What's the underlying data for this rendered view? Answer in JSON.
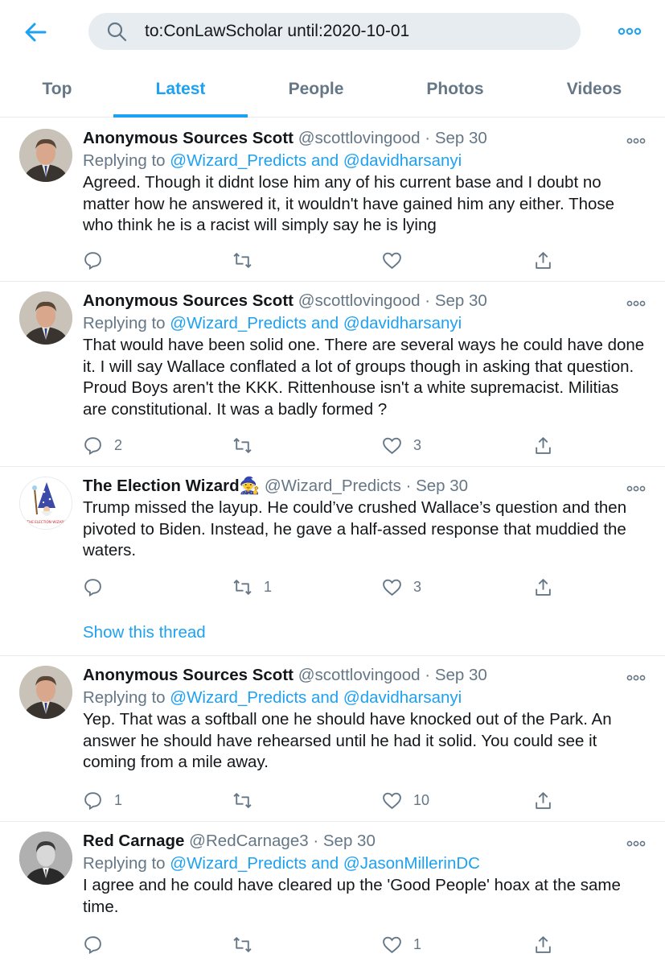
{
  "search": {
    "query": "to:ConLawScholar until:2020-10-01"
  },
  "tabs": [
    "Top",
    "Latest",
    "People",
    "Photos",
    "Videos"
  ],
  "active_tab": "Latest",
  "colors": {
    "accent": "#1da1f2",
    "muted": "#657786",
    "text": "#14171a",
    "divider": "#e6ecf0"
  },
  "tweets": [
    {
      "name": "Anonymous Sources Scott",
      "handle": "@scottlovingood",
      "dot": "·",
      "date": "Sep 30",
      "reply_prefix": "Replying to",
      "reply_to": "@Wizard_Predicts and @davidharsanyi",
      "text": "Agreed. Though it didnt lose him any of his current base and I doubt no matter how he answered it, it wouldn't have gained him any either.  Those who think he is a racist will simply say he is lying",
      "replies": "",
      "retweets": "",
      "likes": "",
      "avatar_icon": "man-portrait-avatar"
    },
    {
      "name": "Anonymous Sources Scott",
      "handle": "@scottlovingood",
      "dot": "·",
      "date": "Sep 30",
      "reply_prefix": "Replying to",
      "reply_to": "@Wizard_Predicts and @davidharsanyi",
      "text": "That would have been solid one.  There are several ways he could have done it.  I will say Wallace conflated a lot of groups though in asking that question.  Proud Boys aren't the KKK.  Rittenhouse isn't a white supremacist.  Militias are constitutional.  It was a badly formed ?",
      "replies": "2",
      "retweets": "",
      "likes": "3",
      "avatar_icon": "man-portrait-avatar"
    },
    {
      "name": "The Election Wizard",
      "name_emoji": "🧙",
      "handle": "@Wizard_Predicts",
      "dot": "·",
      "date": "Sep 30",
      "text": "Trump missed the layup. He could’ve crushed Wallace’s question and then pivoted to Biden. Instead, he gave a half-assed response that muddied the waters.",
      "replies": "",
      "retweets": "1",
      "likes": "3",
      "show_thread": "Show this thread",
      "avatar_icon": "wizard-logo-avatar",
      "avatar_caption": "THE ELECTION WIZARD"
    },
    {
      "name": "Anonymous Sources Scott",
      "handle": "@scottlovingood",
      "dot": "·",
      "date": "Sep 30",
      "reply_prefix": "Replying to",
      "reply_to": "@Wizard_Predicts and @davidharsanyi",
      "text": "Yep. That was a softball one he should have knocked out of the Park.  An answer he should have rehearsed until he had it solid.  You could see it coming from a mile away.",
      "replies": "1",
      "retweets": "",
      "likes": "10",
      "avatar_icon": "man-portrait-avatar"
    },
    {
      "name": "Red Carnage",
      "handle": "@RedCarnage3",
      "dot": "·",
      "date": "Sep 30",
      "reply_prefix": "Replying to",
      "reply_to": "@Wizard_Predicts and @JasonMillerinDC",
      "text": "I agree and he could have cleared up the 'Good People' hoax at the same time.",
      "replies": "",
      "retweets": "",
      "likes": "1",
      "avatar_icon": "bw-portrait-avatar"
    }
  ]
}
